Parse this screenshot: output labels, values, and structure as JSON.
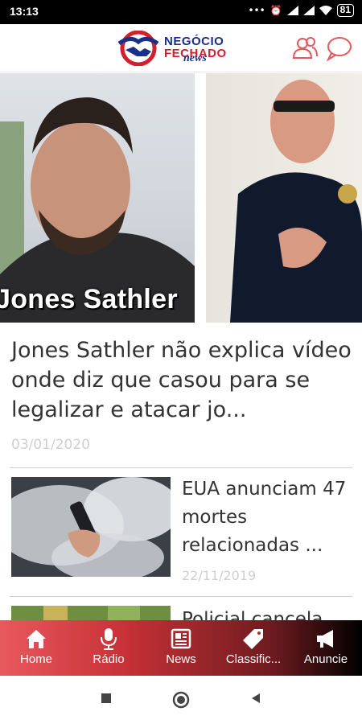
{
  "status_bar": {
    "time": "13:13",
    "battery": "81"
  },
  "header": {
    "logo_line1": "NEGÓCIO",
    "logo_line2": "FECHADO",
    "logo_line3": "news",
    "profile_icon": "user-icon",
    "chat_icon": "chat-bubble-icon",
    "accent_red": "#d0202e",
    "accent_blue": "#1a2f8a"
  },
  "featured": {
    "image_caption": "Jones Sathler",
    "title": "Jones Sathler não explica vídeo onde diz que casou para se legalizar e atacar jo...",
    "date": "03/01/2020"
  },
  "articles": [
    {
      "title": "EUA anunciam 47 mortes relacionadas ...",
      "date": "22/11/2019"
    },
    {
      "title": "Policial cancela"
    }
  ],
  "bottom_nav": [
    {
      "label": "Home",
      "icon": "home-icon"
    },
    {
      "label": "Rádio",
      "icon": "microphone-icon"
    },
    {
      "label": "News",
      "icon": "newspaper-icon"
    },
    {
      "label": "Classific...",
      "icon": "tag-icon"
    },
    {
      "label": "Anuncie",
      "icon": "megaphone-icon"
    }
  ],
  "system_nav": [
    "recents-button",
    "home-button",
    "back-button"
  ]
}
